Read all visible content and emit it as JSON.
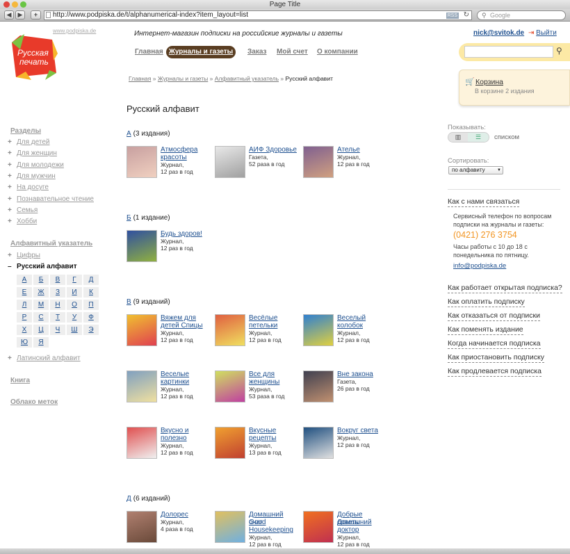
{
  "browser": {
    "title": "Page Title",
    "url": "http://www.podpiska.de/t/alphanumerical-index?item_layout=list",
    "rss": "RSS",
    "search_placeholder": "Google"
  },
  "header": {
    "small_url": "www.podpiska.de",
    "logo_line1": "Русская",
    "logo_line2": "печать",
    "tagline": "Интернет-магазин подписки на российские журналы и газеты",
    "user": "nick@svitok.de",
    "logout": "Выйти",
    "nav": [
      "Главная",
      "Журналы и газеты",
      "Заказ",
      "Мой счет",
      "О компании"
    ]
  },
  "cart": {
    "title": "Корзина",
    "subtitle": "В корзине 2 издания"
  },
  "breadcrumb": {
    "items": [
      "Главная",
      "Журналы и газеты",
      "Алфавитный указатель"
    ],
    "current": "Русский алфавит",
    "sep": "»"
  },
  "page_title": "Русский алфавит",
  "sidebar": {
    "sections_title": "Разделы",
    "sections": [
      "Для детей",
      "Для женщин",
      "Для молодежи",
      "Для мужчин",
      "На досуге",
      "Познавательное чтение",
      "Семья",
      "Хобби"
    ],
    "index_title": "Алфавитный указатель",
    "digits": "Цифры",
    "russian": "Русский алфавит",
    "letters": [
      "А",
      "Б",
      "В",
      "Г",
      "Д",
      "Е",
      "Ж",
      "З",
      "И",
      "К",
      "Л",
      "М",
      "Н",
      "О",
      "П",
      "Р",
      "С",
      "Т",
      "У",
      "Ф",
      "Х",
      "Ц",
      "Ч",
      "Ш",
      "Э",
      "Ю",
      "Я"
    ],
    "latin": "Латинский алфавит",
    "book": "Книга",
    "tags": "Облако меток",
    "plus": "+",
    "minus": "–"
  },
  "sections": [
    {
      "letter": "А",
      "count": "(3 издания)",
      "items": [
        {
          "title": [
            "Атмосфера",
            "красоты"
          ],
          "type": "Журнал,",
          "freq": "12 раз в год"
        },
        {
          "title": [
            "АИФ Здоровье"
          ],
          "type": "Газета,",
          "freq": "52 раза в год"
        },
        {
          "title": [
            "Ателье"
          ],
          "type": "Журнал,",
          "freq": "12 раз в год"
        }
      ]
    },
    {
      "letter": "Б",
      "count": "(1 издание)",
      "items": [
        {
          "title": [
            "Будь здоров!"
          ],
          "type": "Журнал,",
          "freq": "12 раз в год"
        }
      ]
    },
    {
      "letter": "В",
      "count": "(9 изданий)",
      "items": [
        {
          "title": [
            "Вяжем для",
            "детей Спицы"
          ],
          "type": "Журнал,",
          "freq": "12 раз в год"
        },
        {
          "title": [
            "Весёлые",
            "петельки"
          ],
          "type": "Журнал,",
          "freq": "12 раз в год"
        },
        {
          "title": [
            "Веселый",
            "колобок"
          ],
          "type": "Журнал,",
          "freq": "12 раз в год"
        },
        {
          "title": [
            "Веселые",
            "картинки"
          ],
          "type": "Журнал,",
          "freq": "12 раз в год"
        },
        {
          "title": [
            "Все для",
            "женщины"
          ],
          "type": "Журнал,",
          "freq": "53 раза в год"
        },
        {
          "title": [
            "Вне закона"
          ],
          "type": "Газета,",
          "freq": "26 раз в год"
        },
        {
          "title": [
            "Вкусно и",
            "полезно"
          ],
          "type": "Журнал,",
          "freq": "12 раз в год"
        },
        {
          "title": [
            "Вкусные",
            "рецепты"
          ],
          "type": "Журнал,",
          "freq": "13 раз в год"
        },
        {
          "title": [
            "Вокруг света"
          ],
          "type": "Журнал,",
          "freq": "12 раз в год"
        }
      ]
    },
    {
      "letter": "Д",
      "count": "(6 изданий)",
      "items": [
        {
          "title": [
            "Долорес"
          ],
          "type": "Журнал,",
          "freq": "4 раза в год"
        },
        {
          "title": [
            "Домашний очаг",
            "Good",
            "Housekeeping"
          ],
          "type": "Журнал,",
          "freq": "12 раз в год"
        },
        {
          "title": [
            "Добрые советы",
            "Домашний",
            "доктор"
          ],
          "type": "Журнал,",
          "freq": "12 раз в год"
        }
      ]
    }
  ],
  "right": {
    "show_label": "Показывать:",
    "view_list": "списком",
    "sort_label": "Сортировать:",
    "sort_value": "по алфавиту",
    "contact_title": "Как с нами связаться",
    "contact_text": [
      "Сервисный телефон по вопросам",
      "подписки на журналы и газеты:"
    ],
    "phone": "(0421) 276 3754",
    "hours": [
      "Часы работы с 10 до 18 с",
      "понедельника по пятницу."
    ],
    "email": "info@podpiska.de",
    "faq": [
      "Как работает открытая подписка?",
      "Как оплатить подписку",
      "Как отказаться от подписки",
      "Как поменять издание",
      "Когда начинается подписка",
      "Как приостановить подписку",
      "Как продлевается подписка"
    ]
  },
  "colors": {
    "accent": "#5a3e22",
    "phone": "#f29420",
    "link": "#1d4f8f",
    "search_bg": "#fce9a5",
    "cart_bg": "#fdf3dc"
  }
}
